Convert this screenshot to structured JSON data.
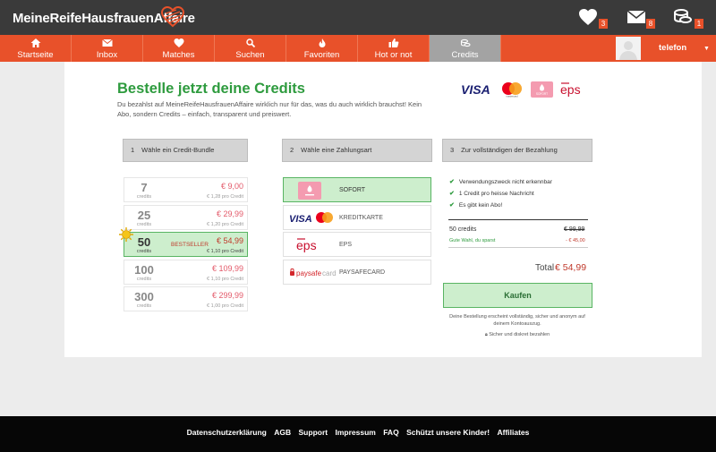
{
  "app": {
    "logo_text": "MeineReifeHausfrauenAffaire"
  },
  "topbar": {
    "likes_count": "3",
    "messages_count": "8",
    "credits_count": "1"
  },
  "nav": {
    "items": [
      {
        "label": "Startseite",
        "icon": "home-icon"
      },
      {
        "label": "Inbox",
        "icon": "envelope-icon"
      },
      {
        "label": "Matches",
        "icon": "heart-icon"
      },
      {
        "label": "Suchen",
        "icon": "search-icon"
      },
      {
        "label": "Favoriten",
        "icon": "flame-icon"
      },
      {
        "label": "Hot or not",
        "icon": "thumbs-up-icon"
      },
      {
        "label": "Credits",
        "icon": "coins-icon"
      }
    ],
    "active": "Credits",
    "username": "telefon"
  },
  "page": {
    "title": "Bestelle jetzt deine Credits",
    "intro": "Du bezahlst auf MeineReifeHausfrauenAffaire wirklich nur für das, was du auch wirklich brauchst! Kein Abo, sondern Credits – einfach, transparent und preiswert."
  },
  "payment_logos": [
    "VISA",
    "mastercard",
    "SOFORT",
    "eps"
  ],
  "steps": [
    {
      "num": "1",
      "label": "Wähle ein Credit-Bundle"
    },
    {
      "num": "2",
      "label": "Wähle eine Zahlungsart"
    },
    {
      "num": "3",
      "label": "Zur vollständigen der Bezahlung"
    }
  ],
  "bundles": [
    {
      "amount": "7",
      "unit": "credits",
      "price": "€ 9,00",
      "per": "€ 1,28 pro Credit",
      "badge": "",
      "selected": false
    },
    {
      "amount": "25",
      "unit": "credits",
      "price": "€ 29,99",
      "per": "€ 1,20 pro Credit",
      "badge": "",
      "selected": false
    },
    {
      "amount": "50",
      "unit": "credits",
      "price": "€ 54,99",
      "per": "€ 1,10 pro Credit",
      "badge": "BESTSELLER",
      "selected": true
    },
    {
      "amount": "100",
      "unit": "credits",
      "price": "€ 109,99",
      "per": "€ 1,10 pro Credit",
      "badge": "",
      "selected": false
    },
    {
      "amount": "300",
      "unit": "credits",
      "price": "€ 299,99",
      "per": "€ 1,00 pro Credit",
      "badge": "",
      "selected": false
    }
  ],
  "methods": [
    {
      "label": "SOFORT",
      "logo": "sofort-logo",
      "selected": true
    },
    {
      "label": "KREDITKARTE",
      "logo": "visa-mastercard-logo",
      "selected": false
    },
    {
      "label": "EPS",
      "logo": "eps-logo",
      "selected": false
    },
    {
      "label": "PAYSAFECARD",
      "logo": "paysafecard-logo",
      "selected": false
    }
  ],
  "summary": {
    "features": [
      "Verwendungszweck nicht erkennbar",
      "1 Credit pro heisse Nachricht",
      "Es gibt kein Abo!"
    ],
    "credits_label": "50 credits",
    "old_price": "€ 99,99",
    "save_label": "Gute Wahl, du sparst",
    "save_value": "- € 45,00",
    "total_label": "Total",
    "total_price": "€ 54,99",
    "buy_label": "Kaufen",
    "note": "Deine Bestellung erscheint vollständig, sicher und anonym auf deinem Kontoauszug.",
    "secure": "Sicher und diskret bezahlen"
  },
  "footer": {
    "links": [
      "Datenschutzerklärung",
      "AGB",
      "Support",
      "Impressum",
      "FAQ",
      "Schützt unsere Kinder!",
      "Affiliates"
    ]
  },
  "colors": {
    "brand_orange": "#e8512a",
    "topbar_dark": "#3a3a3a",
    "headline_green": "#2e9b3e",
    "selected_green_bg": "#cdeecd",
    "price_red": "#c0392b"
  }
}
